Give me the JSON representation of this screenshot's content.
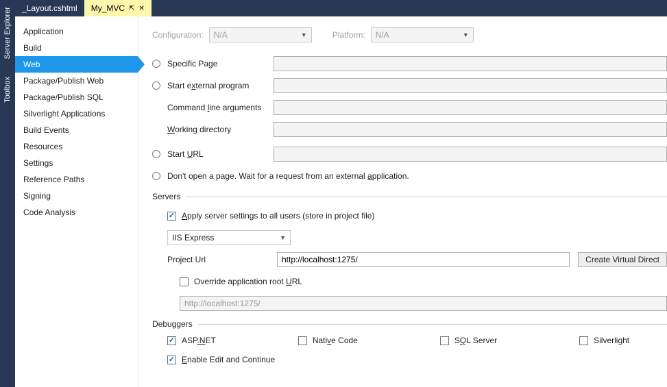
{
  "sideTabs": {
    "t0": "Server Explorer",
    "t1": "Toolbox"
  },
  "docTabs": {
    "t0": "_Layout.cshtml",
    "t1": "My_MVC"
  },
  "categories": {
    "c0": "Application",
    "c1": "Build",
    "c2": "Web",
    "c3": "Package/Publish Web",
    "c4": "Package/Publish SQL",
    "c5": "Silverlight Applications",
    "c6": "Build Events",
    "c7": "Resources",
    "c8": "Settings",
    "c9": "Reference Paths",
    "c10": "Signing",
    "c11": "Code Analysis"
  },
  "top": {
    "configLabel": "Configuration:",
    "configValue": "N/A",
    "platformLabel": "Platform:",
    "platformValue": "N/A"
  },
  "start": {
    "specificPage": "Specific Page",
    "externalProgram": "Start external program",
    "cmdArgs": "Command line arguments",
    "workDir": "Working directory",
    "startUrl": "Start URL",
    "dontOpen": "Don't open a page.  Wait for a request from an external application."
  },
  "servers": {
    "header": "Servers",
    "applyAll": "Apply server settings to all users (store in project file)",
    "serverType": "IIS Express",
    "projectUrlLabel": "Project Url",
    "projectUrl": "http://localhost:1275/",
    "createVdir": "Create Virtual Directory",
    "override": "Override application root URL",
    "overrideVal": "http://localhost:1275/"
  },
  "debuggers": {
    "header": "Debuggers",
    "asp": "ASP.NET",
    "native": "Native Code",
    "sql": "SQL Server",
    "sl": "Silverlight",
    "editContinue": "Enable Edit and Continue"
  }
}
